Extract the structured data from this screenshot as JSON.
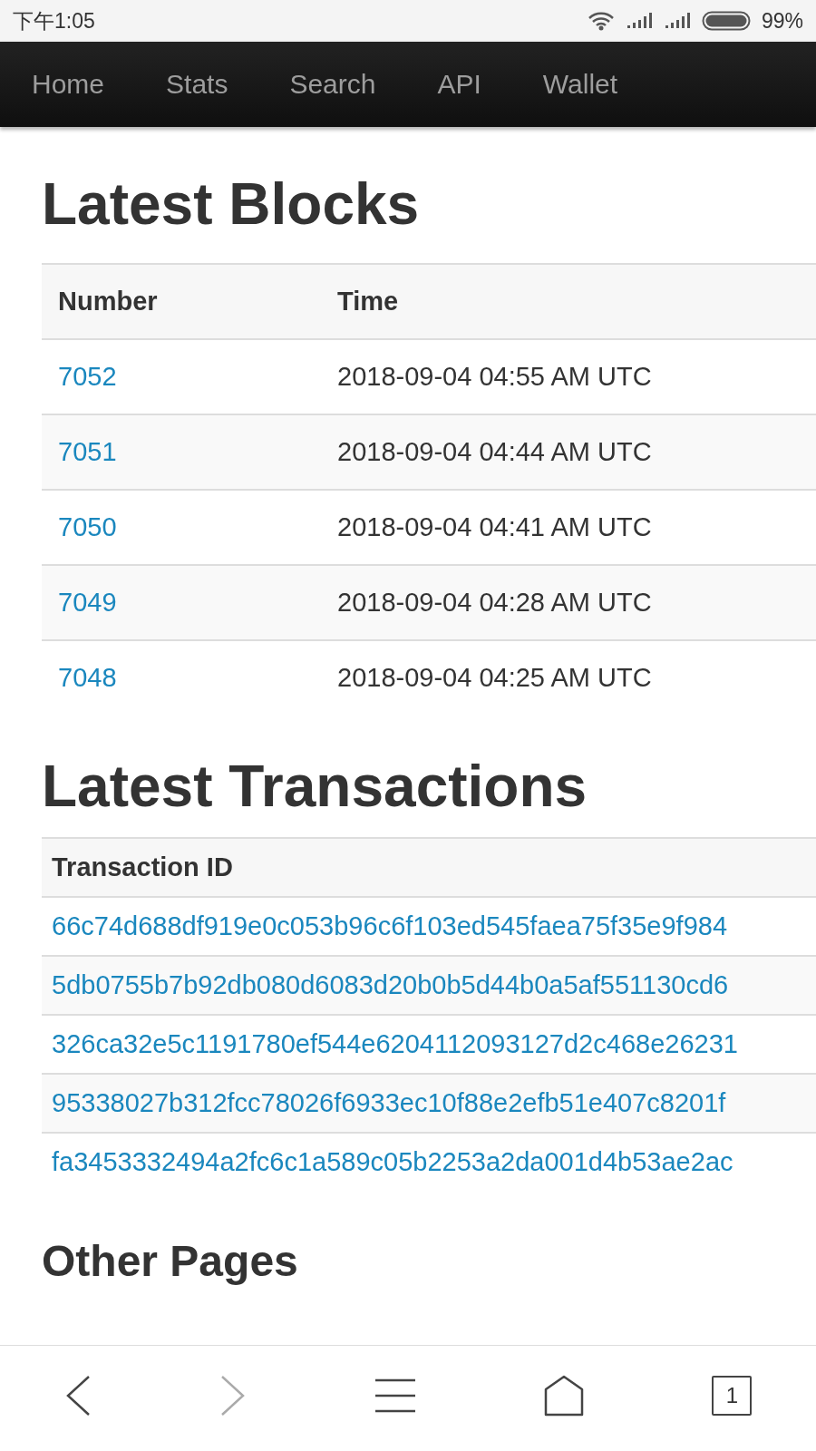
{
  "status_bar": {
    "time": "下午1:05",
    "battery": "99%"
  },
  "nav": [
    {
      "label": "Home"
    },
    {
      "label": "Stats"
    },
    {
      "label": "Search"
    },
    {
      "label": "API"
    },
    {
      "label": "Wallet"
    }
  ],
  "blocks": {
    "title": "Latest Blocks",
    "columns": [
      "Number",
      "Time"
    ],
    "rows": [
      {
        "number": "7052",
        "time": "2018-09-04 04:55 AM UTC"
      },
      {
        "number": "7051",
        "time": "2018-09-04 04:44 AM UTC"
      },
      {
        "number": "7050",
        "time": "2018-09-04 04:41 AM UTC"
      },
      {
        "number": "7049",
        "time": "2018-09-04 04:28 AM UTC"
      },
      {
        "number": "7048",
        "time": "2018-09-04 04:25 AM UTC"
      }
    ]
  },
  "transactions": {
    "title": "Latest Transactions",
    "columns": [
      "Transaction ID"
    ],
    "rows": [
      "66c74d688df919e0c053b96c6f103ed545faea75f35e9f984",
      "5db0755b7b92db080d6083d20b0b5d44b0a5af551130cd6",
      "326ca32e5c1191780ef544e6204112093127d2c468e26231",
      "95338027b312fcc78026f6933ec10f88e2efb51e407c8201f",
      "fa3453332494a2fc6c1a589c05b2253a2da001d4b53ae2ac"
    ]
  },
  "other_pages": {
    "title": "Other Pages"
  },
  "browser_bar": {
    "tab_count": "1"
  }
}
